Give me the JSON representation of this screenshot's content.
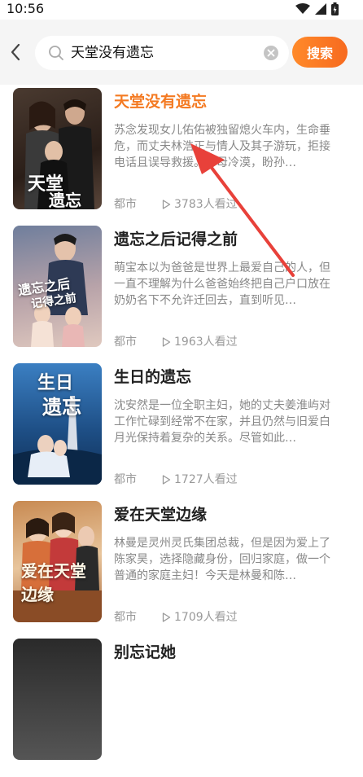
{
  "status": {
    "time": "10:56"
  },
  "search": {
    "query": "天堂没有遗忘",
    "button_label": "搜索"
  },
  "results": [
    {
      "title": "天堂没有遗忘",
      "desc": "苏念发现女儿佑佑被独留熄火车内，生命垂危，而丈夫林浩正与情人及其子游玩，拒接电话且误导救援。林母冷漠，盼孙…",
      "genre": "都市",
      "views": "3783人看过",
      "cover_text": "天堂没有遗忘",
      "cover_colors": [
        "#3a2a22",
        "#7a5a44"
      ]
    },
    {
      "title": "遗忘之后记得之前",
      "desc": "萌宝本以为爸爸是世界上最爱自己的人，但一直不理解为什么爸爸始终把自己户口放在奶奶名下不允许迁回去，直到听见…",
      "genre": "都市",
      "views": "1963人看过",
      "cover_text": "遗忘之后记得之前",
      "cover_colors": [
        "#5a6a8a",
        "#c9a7a2"
      ]
    },
    {
      "title": "生日的遗忘",
      "desc": "沈安然是一位全职主妇，她的丈夫姜淮屿对工作忙碌到经常不在家，并且仍然与旧爱白月光保持着复杂的关系。尽管如此…",
      "genre": "都市",
      "views": "1727人看过",
      "cover_text": "生日的遗忘",
      "cover_colors": [
        "#1f4f86",
        "#6aa3d4"
      ]
    },
    {
      "title": "爱在天堂边缘",
      "desc": "林曼是灵州灵氏集团总裁，但是因为爱上了陈家昊，选择隐藏身份，回归家庭，做一个普通的家庭主妇！今天是林曼和陈…",
      "genre": "都市",
      "views": "1709人看过",
      "cover_text": "爱在天堂边缘",
      "cover_colors": [
        "#b5733f",
        "#e8c8a0"
      ]
    },
    {
      "title": "别忘记她",
      "desc": "",
      "genre": "",
      "views": "",
      "cover_text": "",
      "cover_colors": [
        "#2a2a2a",
        "#555555"
      ]
    }
  ],
  "colors": {
    "accent": "#f47a22",
    "header_bg": "#f5f5f5",
    "arrow": "#e8413a"
  },
  "icons": [
    "back-arrow-icon",
    "search-icon",
    "clear-icon",
    "play-icon",
    "wifi-icon",
    "signal-icon",
    "battery-icon"
  ]
}
